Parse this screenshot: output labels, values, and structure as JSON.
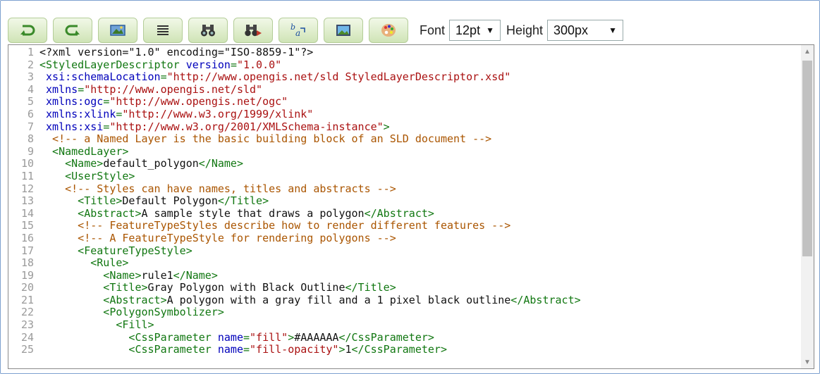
{
  "toolbar": {
    "buttons": [
      {
        "icon": "undo-icon"
      },
      {
        "icon": "redo-icon"
      },
      {
        "icon": "image-icon"
      },
      {
        "icon": "align-text-icon"
      },
      {
        "icon": "binoculars-icon"
      },
      {
        "icon": "find-replace-icon"
      },
      {
        "icon": "font-format-icon"
      },
      {
        "icon": "picture-icon"
      },
      {
        "icon": "palette-icon"
      }
    ],
    "font_label": "Font",
    "font_value": "12pt",
    "height_label": "Height",
    "height_value": "300px"
  },
  "editor": {
    "lines": [
      {
        "n": "1",
        "t": [
          {
            "c": "txt",
            "s": "<?xml version=\"1.0\" encoding=\"ISO-8859-1\"?>"
          }
        ]
      },
      {
        "n": "2",
        "t": [
          {
            "c": "tag",
            "s": "<StyledLayerDescriptor "
          },
          {
            "c": "attr",
            "s": "version"
          },
          {
            "c": "tag",
            "s": "="
          },
          {
            "c": "val",
            "s": "\"1.0.0\""
          }
        ]
      },
      {
        "n": "3",
        "t": [
          {
            "c": "attr",
            "s": " xsi:schemaLocation"
          },
          {
            "c": "tag",
            "s": "="
          },
          {
            "c": "val",
            "s": "\"http://www.opengis.net/sld StyledLayerDescriptor.xsd\""
          }
        ]
      },
      {
        "n": "4",
        "t": [
          {
            "c": "attr",
            "s": " xmlns"
          },
          {
            "c": "tag",
            "s": "="
          },
          {
            "c": "val",
            "s": "\"http://www.opengis.net/sld\""
          }
        ]
      },
      {
        "n": "5",
        "t": [
          {
            "c": "attr",
            "s": " xmlns:ogc"
          },
          {
            "c": "tag",
            "s": "="
          },
          {
            "c": "val",
            "s": "\"http://www.opengis.net/ogc\""
          }
        ]
      },
      {
        "n": "6",
        "t": [
          {
            "c": "attr",
            "s": " xmlns:xlink"
          },
          {
            "c": "tag",
            "s": "="
          },
          {
            "c": "val",
            "s": "\"http://www.w3.org/1999/xlink\""
          }
        ]
      },
      {
        "n": "7",
        "t": [
          {
            "c": "attr",
            "s": " xmlns:xsi"
          },
          {
            "c": "tag",
            "s": "="
          },
          {
            "c": "val",
            "s": "\"http://www.w3.org/2001/XMLSchema-instance\""
          },
          {
            "c": "tag",
            "s": ">"
          }
        ]
      },
      {
        "n": "8",
        "t": [
          {
            "c": "cmt",
            "s": "  <!-- a Named Layer is the basic building block of an SLD document -->"
          }
        ]
      },
      {
        "n": "9",
        "t": [
          {
            "c": "tag",
            "s": "  <NamedLayer>"
          }
        ]
      },
      {
        "n": "10",
        "t": [
          {
            "c": "tag",
            "s": "    <Name>"
          },
          {
            "c": "txt",
            "s": "default_polygon"
          },
          {
            "c": "tag",
            "s": "</Name>"
          }
        ]
      },
      {
        "n": "11",
        "t": [
          {
            "c": "tag",
            "s": "    <UserStyle>"
          }
        ]
      },
      {
        "n": "12",
        "t": [
          {
            "c": "cmt",
            "s": "    <!-- Styles can have names, titles and abstracts -->"
          }
        ]
      },
      {
        "n": "13",
        "t": [
          {
            "c": "tag",
            "s": "      <Title>"
          },
          {
            "c": "txt",
            "s": "Default Polygon"
          },
          {
            "c": "tag",
            "s": "</Title>"
          }
        ]
      },
      {
        "n": "14",
        "t": [
          {
            "c": "tag",
            "s": "      <Abstract>"
          },
          {
            "c": "txt",
            "s": "A sample style that draws a polygon"
          },
          {
            "c": "tag",
            "s": "</Abstract>"
          }
        ]
      },
      {
        "n": "15",
        "t": [
          {
            "c": "cmt",
            "s": "      <!-- FeatureTypeStyles describe how to render different features -->"
          }
        ]
      },
      {
        "n": "16",
        "t": [
          {
            "c": "cmt",
            "s": "      <!-- A FeatureTypeStyle for rendering polygons -->"
          }
        ]
      },
      {
        "n": "17",
        "t": [
          {
            "c": "tag",
            "s": "      <FeatureTypeStyle>"
          }
        ]
      },
      {
        "n": "18",
        "t": [
          {
            "c": "tag",
            "s": "        <Rule>"
          }
        ]
      },
      {
        "n": "19",
        "t": [
          {
            "c": "tag",
            "s": "          <Name>"
          },
          {
            "c": "txt",
            "s": "rule1"
          },
          {
            "c": "tag",
            "s": "</Name>"
          }
        ]
      },
      {
        "n": "20",
        "t": [
          {
            "c": "tag",
            "s": "          <Title>"
          },
          {
            "c": "txt",
            "s": "Gray Polygon with Black Outline"
          },
          {
            "c": "tag",
            "s": "</Title>"
          }
        ]
      },
      {
        "n": "21",
        "t": [
          {
            "c": "tag",
            "s": "          <Abstract>"
          },
          {
            "c": "txt",
            "s": "A polygon with a gray fill and a 1 pixel black outline"
          },
          {
            "c": "tag",
            "s": "</Abstract>"
          }
        ]
      },
      {
        "n": "22",
        "t": [
          {
            "c": "tag",
            "s": "          <PolygonSymbolizer>"
          }
        ]
      },
      {
        "n": "23",
        "t": [
          {
            "c": "tag",
            "s": "            <Fill>"
          }
        ]
      },
      {
        "n": "24",
        "t": [
          {
            "c": "tag",
            "s": "              <CssParameter "
          },
          {
            "c": "attr",
            "s": "name"
          },
          {
            "c": "tag",
            "s": "="
          },
          {
            "c": "val",
            "s": "\"fill\""
          },
          {
            "c": "tag",
            "s": ">"
          },
          {
            "c": "txt",
            "s": "#AAAAAA"
          },
          {
            "c": "tag",
            "s": "</CssParameter>"
          }
        ]
      },
      {
        "n": "25",
        "t": [
          {
            "c": "tag",
            "s": "              <CssParameter "
          },
          {
            "c": "attr",
            "s": "name"
          },
          {
            "c": "tag",
            "s": "="
          },
          {
            "c": "val",
            "s": "\"fill-opacity\""
          },
          {
            "c": "tag",
            "s": ">"
          },
          {
            "c": "txt",
            "s": "1"
          },
          {
            "c": "tag",
            "s": "</CssParameter>"
          }
        ]
      }
    ]
  }
}
